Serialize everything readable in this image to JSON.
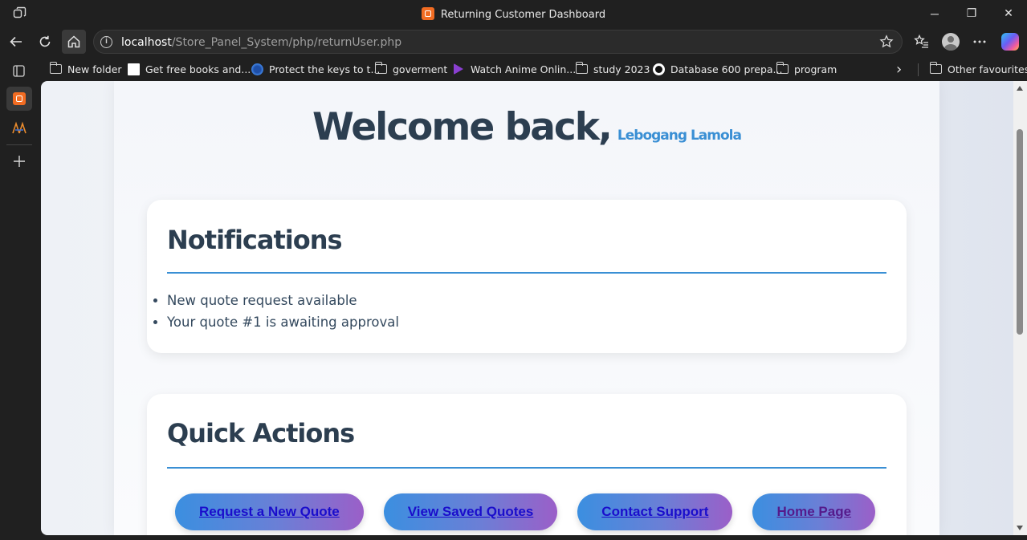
{
  "window": {
    "title": "Returning Customer Dashboard",
    "controls": {
      "minimize": "─",
      "restore": "❐",
      "close": "✕"
    }
  },
  "address_bar": {
    "host": "localhost",
    "path": "/Store_Panel_System/php/returnUser.php",
    "info_symbol": "i"
  },
  "bookmarks": {
    "items": [
      {
        "label": "New folder",
        "icon": "folder-icon"
      },
      {
        "label": "Get free books and...",
        "icon": "page-icon"
      },
      {
        "label": "Protect the keys to t...",
        "icon": "shield-icon"
      },
      {
        "label": "goverment",
        "icon": "folder-icon"
      },
      {
        "label": "Watch Anime Onlin...",
        "icon": "play-icon"
      },
      {
        "label": "study 2023",
        "icon": "folder-icon"
      },
      {
        "label": "Database 600 prepa...",
        "icon": "site-icon"
      },
      {
        "label": "program",
        "icon": "folder-icon"
      }
    ],
    "more_symbol": "›",
    "other": "Other favourites"
  },
  "page": {
    "welcome": "Welcome back,",
    "user_name": "Lebogang Lamola",
    "notifications": {
      "title": "Notifications",
      "items": [
        "New quote request available",
        "Your quote #1 is awaiting approval"
      ]
    },
    "quick_actions": {
      "title": "Quick Actions",
      "buttons": [
        "Request a New Quote",
        "View Saved Quotes",
        "Contact Support",
        "Home Page"
      ]
    }
  },
  "colors": {
    "heading": "#2c3e50",
    "accent": "#3a8fd4",
    "button_gradient_start": "#3b8fe0",
    "button_gradient_end": "#9b5fc8",
    "link": "#1a0dcc",
    "visited_link": "#551a8b"
  }
}
